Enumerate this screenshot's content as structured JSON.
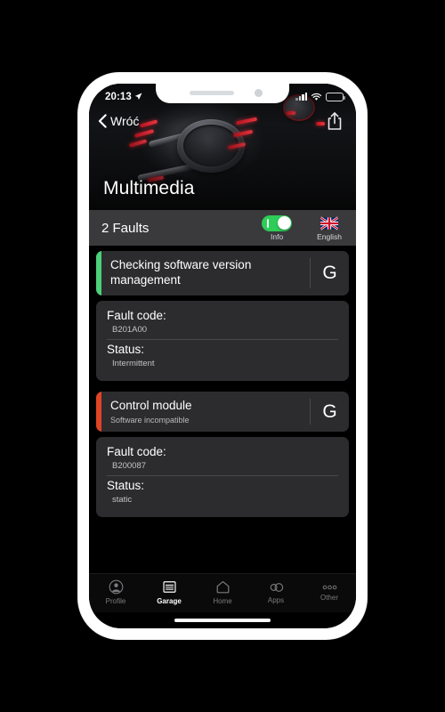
{
  "status_bar": {
    "time": "20:13",
    "location_icon": "location-arrow-icon",
    "signal_icon": "cellular-signal-icon",
    "wifi_icon": "wifi-icon",
    "battery_icon": "battery-icon",
    "battery_level_pct": 40
  },
  "nav": {
    "back_label": "Wróć",
    "back_icon": "chevron-left-icon",
    "share_icon": "share-icon"
  },
  "hero": {
    "title": "Multimedia",
    "image_alt": "car-center-console-mmi-knob"
  },
  "toolbar": {
    "faults_count_label": "2 Faults",
    "info_toggle": {
      "label": "Info",
      "enabled": true,
      "on_color": "#2ecc58"
    },
    "language": {
      "label": "English",
      "flag": "union-jack-flag"
    }
  },
  "faults": [
    {
      "title": "Checking software version management",
      "subtitle": "",
      "severity_color": "#4cd07a",
      "search_icon_label": "G",
      "details": [
        {
          "label": "Fault code:",
          "value": "B201A00"
        },
        {
          "label": "Status:",
          "value": "Intermittent"
        }
      ]
    },
    {
      "title": "Control module",
      "subtitle": "Software incompatible",
      "severity_color": "#e04424",
      "search_icon_label": "G",
      "details": [
        {
          "label": "Fault code:",
          "value": "B200087"
        },
        {
          "label": "Status:",
          "value": "static"
        }
      ]
    }
  ],
  "tab_bar": {
    "items": [
      {
        "label": "Profile",
        "icon": "person-circle-icon",
        "active": false
      },
      {
        "label": "Garage",
        "icon": "garage-door-icon",
        "active": true
      },
      {
        "label": "Home",
        "icon": "home-icon",
        "active": false
      },
      {
        "label": "Apps",
        "icon": "apps-rings-icon",
        "active": false
      },
      {
        "label": "Other",
        "icon": "three-dots-icon",
        "active": false
      }
    ]
  }
}
